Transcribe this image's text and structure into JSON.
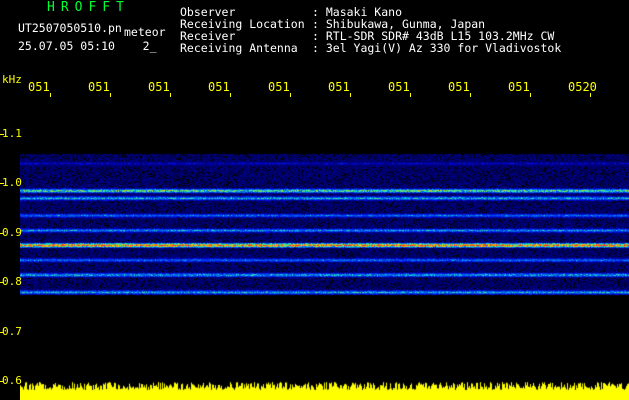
{
  "header": {
    "title": "HROFFT",
    "filename": "UT2507050510.pn",
    "meteor_label": "meteor",
    "datetime": "25.07.05 05:10",
    "counter": "2_"
  },
  "info": {
    "observer_key": "Observer",
    "observer_val": ": Masaki Kano",
    "location_key": "Receiving Location",
    "location_val": ": Shibukawa, Gunma, Japan",
    "receiver_key": "Receiver",
    "receiver_val": ": RTL-SDR SDR# 43dB L15 103.2MHz CW",
    "antenna_key": "Receiving Antenna",
    "antenna_val": ": 3el Yagi(V) Az 330 for Vladivostok"
  },
  "chart_data": {
    "type": "heatmap",
    "y_unit": "kHz",
    "y_ticks": [
      "1.1",
      "1.0",
      "0.9",
      "0.8",
      "0.7",
      "0.6"
    ],
    "x_ticks": [
      "051",
      "051",
      "051",
      "051",
      "051",
      "051",
      "051",
      "051",
      "051",
      "0520"
    ],
    "ylim": [
      0.6,
      1.15
    ],
    "bands_khz": [
      {
        "f": 1.04,
        "intensity": 0.25
      },
      {
        "f": 0.985,
        "intensity": 0.7
      },
      {
        "f": 0.97,
        "intensity": 0.55
      },
      {
        "f": 0.935,
        "intensity": 0.45
      },
      {
        "f": 0.905,
        "intensity": 0.5
      },
      {
        "f": 0.875,
        "intensity": 1.0
      },
      {
        "f": 0.845,
        "intensity": 0.45
      },
      {
        "f": 0.815,
        "intensity": 0.55
      },
      {
        "f": 0.78,
        "intensity": 0.55
      }
    ],
    "colors": {
      "background": "#000000",
      "noise": "#0a0a8a",
      "signal": "#ff2020",
      "noise_floor": "#ffff00",
      "axis": "#ffff00"
    }
  }
}
